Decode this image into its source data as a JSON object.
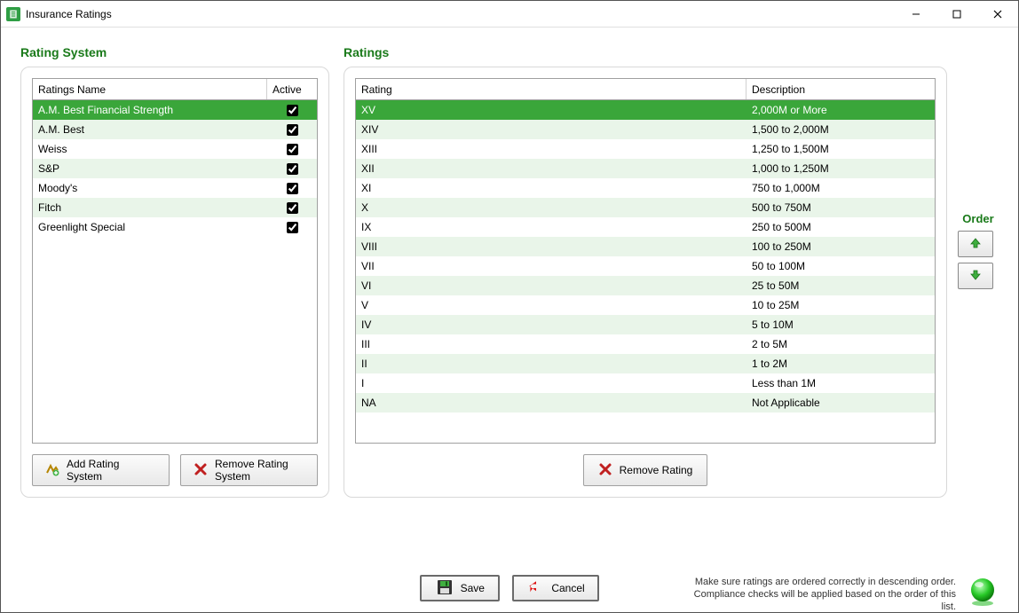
{
  "window": {
    "title": "Insurance Ratings"
  },
  "left": {
    "title": "Rating System",
    "columns": {
      "name": "Ratings Name",
      "active": "Active"
    },
    "rows": [
      {
        "name": "A.M. Best Financial Strength",
        "active": true,
        "selected": true
      },
      {
        "name": "A.M. Best",
        "active": true,
        "selected": false
      },
      {
        "name": "Weiss",
        "active": true,
        "selected": false
      },
      {
        "name": "S&P",
        "active": true,
        "selected": false
      },
      {
        "name": "Moody's",
        "active": true,
        "selected": false
      },
      {
        "name": "Fitch",
        "active": true,
        "selected": false
      },
      {
        "name": "Greenlight Special",
        "active": true,
        "selected": false
      }
    ],
    "buttons": {
      "add": "Add Rating System",
      "remove": "Remove Rating System"
    }
  },
  "right": {
    "title": "Ratings",
    "columns": {
      "rating": "Rating",
      "desc": "Description"
    },
    "rows": [
      {
        "rating": "XV",
        "desc": "2,000M or More",
        "selected": true
      },
      {
        "rating": "XIV",
        "desc": "1,500 to 2,000M",
        "selected": false
      },
      {
        "rating": "XIII",
        "desc": "1,250 to 1,500M",
        "selected": false
      },
      {
        "rating": "XII",
        "desc": "1,000 to 1,250M",
        "selected": false
      },
      {
        "rating": "XI",
        "desc": "750 to 1,000M",
        "selected": false
      },
      {
        "rating": "X",
        "desc": "500 to 750M",
        "selected": false
      },
      {
        "rating": "IX",
        "desc": "250 to 500M",
        "selected": false
      },
      {
        "rating": "VIII",
        "desc": "100 to 250M",
        "selected": false
      },
      {
        "rating": "VII",
        "desc": "50 to 100M",
        "selected": false
      },
      {
        "rating": "VI",
        "desc": "25 to 50M",
        "selected": false
      },
      {
        "rating": "V",
        "desc": "10 to 25M",
        "selected": false
      },
      {
        "rating": "IV",
        "desc": "5 to 10M",
        "selected": false
      },
      {
        "rating": "III",
        "desc": "2 to 5M",
        "selected": false
      },
      {
        "rating": "II",
        "desc": "1 to 2M",
        "selected": false
      },
      {
        "rating": "I",
        "desc": "Less than 1M",
        "selected": false
      },
      {
        "rating": "NA",
        "desc": "Not Applicable",
        "selected": false
      }
    ],
    "remove_label": "Remove Rating",
    "order_label": "Order"
  },
  "footer": {
    "save": "Save",
    "cancel": "Cancel",
    "note": "Make sure ratings are ordered correctly in descending order. Compliance checks will be applied based on the order of this list."
  }
}
